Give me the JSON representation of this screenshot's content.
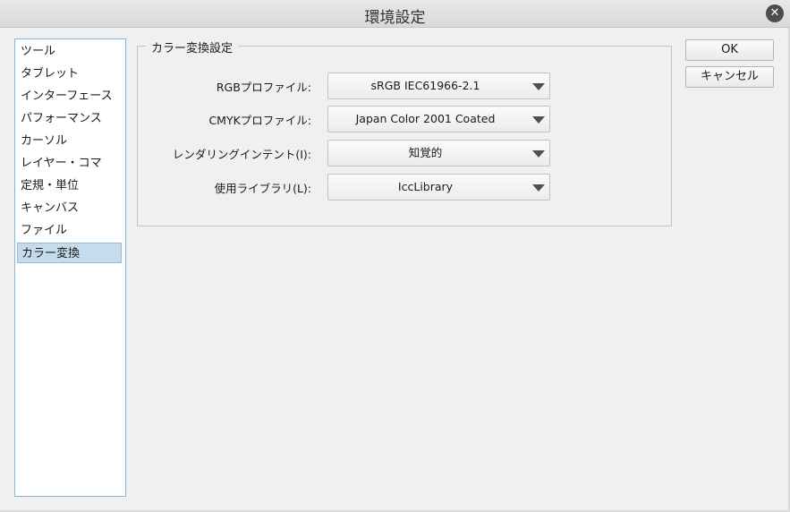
{
  "window": {
    "title": "環境設定",
    "close_glyph": "✕"
  },
  "sidebar": {
    "items": [
      {
        "label": "ツール"
      },
      {
        "label": "タブレット"
      },
      {
        "label": "インターフェース"
      },
      {
        "label": "パフォーマンス"
      },
      {
        "label": "カーソル"
      },
      {
        "label": "レイヤー・コマ"
      },
      {
        "label": "定規・単位"
      },
      {
        "label": "キャンバス"
      },
      {
        "label": "ファイル"
      },
      {
        "label": "カラー変換",
        "selected": true
      }
    ]
  },
  "color_conversion": {
    "legend": "カラー変換設定",
    "rows": [
      {
        "label": "RGBプロファイル:",
        "value": "sRGB IEC61966-2.1"
      },
      {
        "label": "CMYKプロファイル:",
        "value": "Japan Color 2001 Coated"
      },
      {
        "label": "レンダリングインテント(I):",
        "value": "知覚的"
      },
      {
        "label": "使用ライブラリ(L):",
        "value": "IccLibrary"
      }
    ]
  },
  "buttons": {
    "ok": "OK",
    "cancel": "キャンセル"
  }
}
